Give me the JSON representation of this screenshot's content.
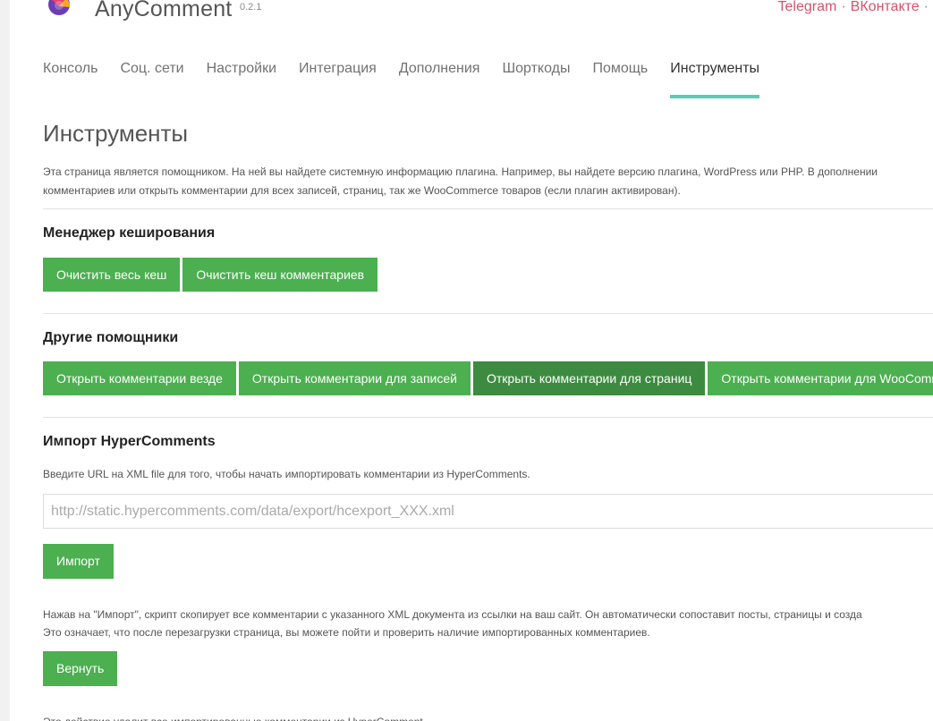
{
  "brand": {
    "name": "AnyComment",
    "version": "0.2.1"
  },
  "header_links": {
    "telegram": "Telegram",
    "separator": "·",
    "vk": "ВКонтакте"
  },
  "tabs": [
    {
      "label": "Консоль"
    },
    {
      "label": "Соц. сети"
    },
    {
      "label": "Настройки"
    },
    {
      "label": "Интеграция"
    },
    {
      "label": "Дополнения"
    },
    {
      "label": "Шорткоды"
    },
    {
      "label": "Помощь"
    },
    {
      "label": "Инструменты",
      "active": true
    }
  ],
  "page": {
    "title": "Инструменты",
    "intro_line1": "Эта страница является помощником. На ней вы найдете системную информацию плагина. Например, вы найдете версию плагина, WordPress или PHP. В дополнении",
    "intro_line2": "комментариев или открыть комментарии для всех записей, страниц, так же WooCommerce товаров (если плагин активирован)."
  },
  "cache": {
    "heading": "Менеджер кеширования",
    "clear_all": "Очистить весь кеш",
    "clear_comments": "Очистить кеш комментариев"
  },
  "helpers": {
    "heading": "Другие помощники",
    "open_everywhere": "Открыть комментарии везде",
    "open_posts": "Открыть комментарии для записей",
    "open_pages": "Открыть комментарии для страниц",
    "open_woo": "Открыть комментарии для WooCommerce"
  },
  "import": {
    "heading": "Импорт HyperComments",
    "hint": "Введите URL на XML file для того, чтобы начать импортировать комментарии из HyperComments.",
    "placeholder": "http://static.hypercomments.com/data/export/hcexport_XXX.xml",
    "import_button": "Импорт",
    "note_line1": "Нажав на \"Импорт\", скрипт скопирует все комментарии с указанного XML документа из ссылки на ваш сайт. Он автоматически сопоставит посты, страницы и созда",
    "note_line2": "Это означает, что после перезагрузки страница, вы можете пойти и проверить наличие импортированных комментариев.",
    "revert_button": "Вернуть",
    "revert_note": "Это действие удалит все импортированные комментарии из HyperComment."
  },
  "colors": {
    "accent_tab": "#5dc9b5",
    "button_green": "#4caf50",
    "button_green_active": "#3d8b40",
    "link_red": "#d5536b"
  }
}
